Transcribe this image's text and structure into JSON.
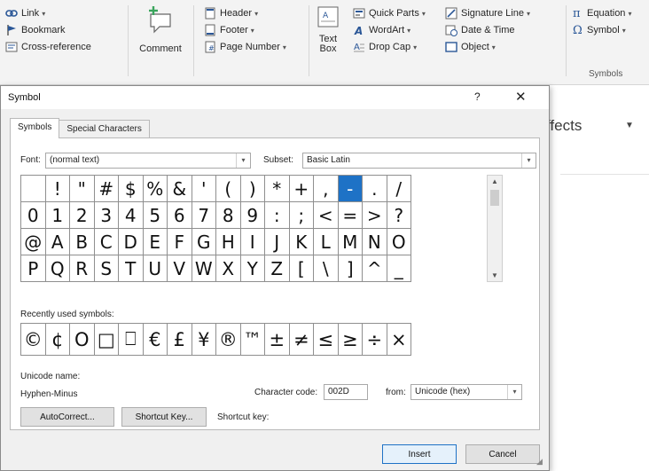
{
  "ribbon": {
    "links": {
      "link": "Link",
      "bookmark": "Bookmark",
      "cross_reference": "Cross-reference"
    },
    "comment": "Comment",
    "header_footer": {
      "header": "Header",
      "footer": "Footer",
      "page_number": "Page Number"
    },
    "text_box": {
      "line1": "Text",
      "line2": "Box"
    },
    "text": {
      "quick_parts": "Quick Parts",
      "wordart": "WordArt",
      "drop_cap": "Drop Cap"
    },
    "text_right": {
      "signature_line": "Signature Line",
      "date_time": "Date & Time",
      "object": "Object"
    },
    "symbols": {
      "equation": "Equation",
      "symbol": "Symbol",
      "group_label": "Symbols"
    },
    "effects": "ffects"
  },
  "dialog": {
    "title": "Symbol",
    "help": "?",
    "close": "✕",
    "tabs": [
      "Symbols",
      "Special Characters"
    ],
    "font_label": "Font:",
    "font_value": "(normal text)",
    "subset_label": "Subset:",
    "subset_value": "Basic Latin",
    "grid": [
      [
        " ",
        "!",
        "\"",
        "#",
        "$",
        "%",
        "&",
        "'",
        "(",
        ")",
        "*",
        "+",
        ",",
        "-",
        ".",
        "/"
      ],
      [
        "0",
        "1",
        "2",
        "3",
        "4",
        "5",
        "6",
        "7",
        "8",
        "9",
        ":",
        ";",
        "<",
        "=",
        ">",
        "?"
      ],
      [
        "@",
        "A",
        "B",
        "C",
        "D",
        "E",
        "F",
        "G",
        "H",
        "I",
        "J",
        "K",
        "L",
        "M",
        "N",
        "O"
      ],
      [
        "P",
        "Q",
        "R",
        "S",
        "T",
        "U",
        "V",
        "W",
        "X",
        "Y",
        "Z",
        "[",
        "\\",
        "]",
        "^",
        "_"
      ]
    ],
    "selected_symbol": "-",
    "recent_label": "Recently used symbols:",
    "recent": [
      "©",
      "¢",
      "O",
      "□",
      "⎕",
      "€",
      "£",
      "¥",
      "®",
      "™",
      "±",
      "≠",
      "≤",
      "≥",
      "÷",
      "×"
    ],
    "unicode_name_label": "Unicode name:",
    "unicode_name_value": "Hyphen-Minus",
    "char_code_label": "Character code:",
    "char_code_value": "002D",
    "from_label": "from:",
    "from_value": "Unicode (hex)",
    "autocorrect": "AutoCorrect...",
    "shortcut_key_button": "Shortcut Key...",
    "shortcut_key_label": "Shortcut key:",
    "insert": "Insert",
    "cancel": "Cancel"
  },
  "colors": {
    "accent": "#1e72c6",
    "ribbon_bg": "#f3f3f3",
    "dialog_bg": "#f0f0f0"
  }
}
